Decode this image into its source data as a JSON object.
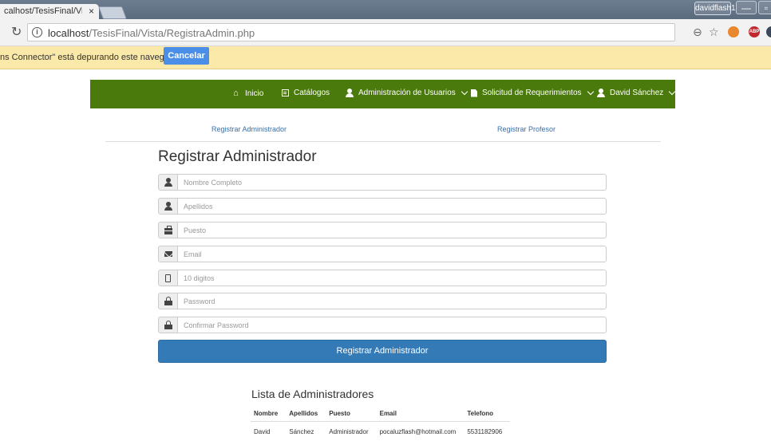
{
  "browser": {
    "tab_title": "calhost/TesisFinal/Vista",
    "tab_close": "×",
    "profile_name": "davidflash1",
    "url_host": "localhost",
    "url_path": "/TesisFinal/Vista/RegistraAdmin.php",
    "extension_label": "ABP"
  },
  "infobar": {
    "message": "ns Connector\" está depurando este navegador.",
    "cancel_label": "Cancelar",
    "color": "#fbe9a9"
  },
  "navbar": {
    "color": "#4a7a0b",
    "items": [
      {
        "label": "Inicio",
        "icon": "home-icon"
      },
      {
        "label": "Catálogos",
        "icon": "list-icon"
      },
      {
        "label": "Administración de Usuarios",
        "icon": "user-icon",
        "dropdown": true
      },
      {
        "label": "Solicitud de Requerimientos",
        "icon": "document-icon",
        "dropdown": true
      },
      {
        "label": "David Sánchez",
        "icon": "user-icon",
        "dropdown": true
      }
    ]
  },
  "subnav": {
    "left": "Registrar Administrador",
    "right": "Registrar Profesor"
  },
  "form": {
    "title": "Registrar Administrador",
    "fields": [
      {
        "placeholder": "Nombre Completo",
        "icon": "user-icon"
      },
      {
        "placeholder": "Apellidos",
        "icon": "user-icon"
      },
      {
        "placeholder": "Puesto",
        "icon": "briefcase-icon"
      },
      {
        "placeholder": "Email",
        "icon": "envelope-icon"
      },
      {
        "placeholder": "10 digitos",
        "icon": "phone-icon"
      },
      {
        "placeholder": "Password",
        "icon": "lock-icon"
      },
      {
        "placeholder": "Confirmar Password",
        "icon": "lock-icon"
      }
    ],
    "submit_label": "Registrar Administrador",
    "submit_color": "#337ab7"
  },
  "admins": {
    "title": "Lista de Administradores",
    "columns": [
      "Nombre",
      "Apellidos",
      "Puesto",
      "Email",
      "Telefono"
    ],
    "rows": [
      [
        "David",
        "Sánchez",
        "Administrador",
        "pocaluzflash@hotmail.com",
        "5531182906"
      ]
    ]
  }
}
